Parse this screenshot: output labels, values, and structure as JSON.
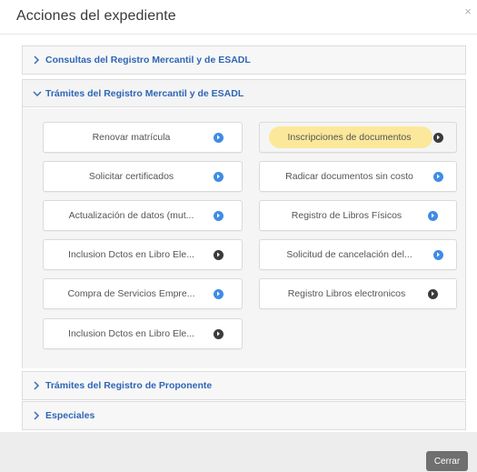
{
  "dialog": {
    "title": "Acciones del expediente",
    "close_glyph": "×",
    "close_button_label": "Cerrar"
  },
  "sections": [
    {
      "label": "Consultas del Registro Mercantil y de ESADL",
      "expanded": false
    },
    {
      "label": "Trámites del Registro Mercantil y de ESADL",
      "expanded": true
    },
    {
      "label": "Trámites del Registro de Proponente",
      "expanded": false
    },
    {
      "label": "Especiales",
      "expanded": false
    }
  ],
  "actions": [
    {
      "label": "Renovar matrícula",
      "icon": "blue"
    },
    {
      "label": "Inscripciones de documentos",
      "icon": "dark",
      "highlighted": true
    },
    {
      "label": "Solicitar certificados",
      "icon": "blue"
    },
    {
      "label": "Radicar documentos sin costo",
      "icon": "blue"
    },
    {
      "label": "Actualización de datos (mut...",
      "icon": "blue"
    },
    {
      "label": "Registro de Libros Físicos",
      "icon": "blue"
    },
    {
      "label": "Inclusion Dctos en Libro Ele...",
      "icon": "dark"
    },
    {
      "label": "Solicitud de cancelación del...",
      "icon": "blue"
    },
    {
      "label": "Compra de Servicios Empre...",
      "icon": "blue"
    },
    {
      "label": "Registro Libros electronicos",
      "icon": "dark"
    },
    {
      "label": "Inclusion Dctos en Libro Ele...",
      "icon": "dark"
    }
  ],
  "colors": {
    "section_label": "#2f66b5",
    "icon_blue": "#3f8ce5",
    "icon_dark": "#3b3b3b",
    "highlight": "#fbe58b",
    "close_button": "#6f6f6f"
  }
}
